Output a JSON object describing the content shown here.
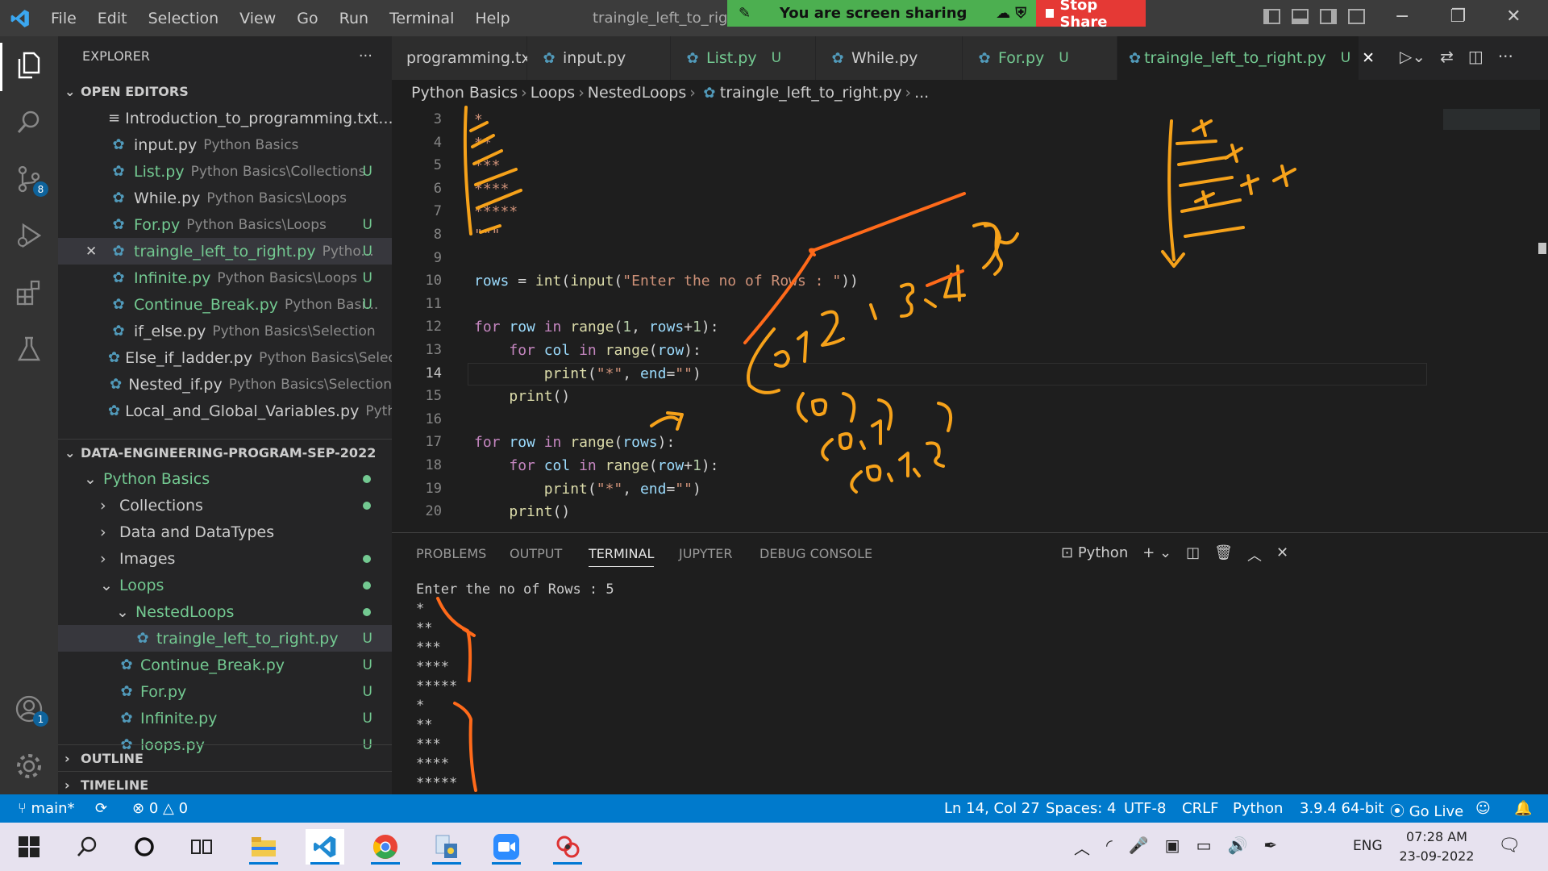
{
  "title_bar": {
    "menu": [
      "File",
      "Edit",
      "Selection",
      "View",
      "Go",
      "Run",
      "Terminal",
      "Help"
    ],
    "window_title": "traingle_left_to_right.",
    "share_message": "You are screen sharing",
    "stop_share": "Stop Share"
  },
  "activity_bar": {
    "source_control_badge": "8",
    "accounts_badge": "1"
  },
  "explorer": {
    "title": "EXPLORER",
    "more": "···",
    "open_editors_title": "OPEN EDITORS",
    "open_editors": [
      {
        "name": "Introduction_to_programming.txt...",
        "desc": "",
        "status": "",
        "icon": "text-file-icon"
      },
      {
        "name": "input.py",
        "desc": "Python Basics",
        "status": ""
      },
      {
        "name": "List.py",
        "desc": "Python Basics\\Collections",
        "status": "U"
      },
      {
        "name": "While.py",
        "desc": "Python Basics\\Loops",
        "status": ""
      },
      {
        "name": "For.py",
        "desc": "Python Basics\\Loops",
        "status": "U"
      },
      {
        "name": "traingle_left_to_right.py",
        "desc": "Pytho...",
        "status": "U"
      },
      {
        "name": "Infinite.py",
        "desc": "Python Basics\\Loops",
        "status": "U"
      },
      {
        "name": "Continue_Break.py",
        "desc": "Python Basi...",
        "status": "U"
      },
      {
        "name": "if_else.py",
        "desc": "Python Basics\\Selection",
        "status": ""
      },
      {
        "name": "Else_if_ladder.py",
        "desc": "Python Basics\\Selec...",
        "status": ""
      },
      {
        "name": "Nested_if.py",
        "desc": "Python Basics\\Selection",
        "status": ""
      },
      {
        "name": "Local_and_Global_Variables.py",
        "desc": "Pyth...",
        "status": ""
      }
    ],
    "workspace_title": "DATA-ENGINEERING-PROGRAM-SEP-2022",
    "tree": [
      {
        "name": "Python Basics",
        "type": "folder-open",
        "indent": 1,
        "dot": true
      },
      {
        "name": "Collections",
        "type": "folder",
        "indent": 2,
        "dot": true
      },
      {
        "name": "Data and DataTypes",
        "type": "folder",
        "indent": 2,
        "dot": false
      },
      {
        "name": "Images",
        "type": "folder",
        "indent": 2,
        "dot": true
      },
      {
        "name": "Loops",
        "type": "folder-open",
        "indent": 2,
        "dot": true
      },
      {
        "name": "NestedLoops",
        "type": "folder-open",
        "indent": 3,
        "dot": true
      },
      {
        "name": "traingle_left_to_right.py",
        "type": "file",
        "indent": 4,
        "status": "U"
      },
      {
        "name": "Continue_Break.py",
        "type": "file",
        "indent": 3,
        "status": "U"
      },
      {
        "name": "For.py",
        "type": "file",
        "indent": 3,
        "status": "U"
      },
      {
        "name": "Infinite.py",
        "type": "file",
        "indent": 3,
        "status": "U"
      },
      {
        "name": "loops.py",
        "type": "file",
        "indent": 3,
        "status": "U"
      }
    ],
    "outline": "OUTLINE",
    "timeline": "TIMELINE"
  },
  "tabs": [
    {
      "name": "programming.txt",
      "status": ""
    },
    {
      "name": "input.py",
      "status": ""
    },
    {
      "name": "List.py",
      "status": "U"
    },
    {
      "name": "While.py",
      "status": ""
    },
    {
      "name": "For.py",
      "status": "U"
    },
    {
      "name": "traingle_left_to_right.py",
      "status": "U"
    }
  ],
  "breadcrumb": [
    "Python Basics",
    "Loops",
    "NestedLoops",
    "traingle_left_to_right.py",
    "..."
  ],
  "editor": {
    "lines": [
      {
        "n": "3",
        "t": "*"
      },
      {
        "n": "4",
        "t": "**"
      },
      {
        "n": "5",
        "t": "***"
      },
      {
        "n": "6",
        "t": "****"
      },
      {
        "n": "7",
        "t": "*****"
      },
      {
        "n": "8",
        "t": "\"\"\""
      },
      {
        "n": "9",
        "t": ""
      },
      {
        "n": "10",
        "t": "rows = int(input(\"Enter the no of Rows : \"))"
      },
      {
        "n": "11",
        "t": ""
      },
      {
        "n": "12",
        "t": "for row in range(1, rows+1):"
      },
      {
        "n": "13",
        "t": "    for col in range(row):"
      },
      {
        "n": "14",
        "t": "        print(\"*\", end=\"\")"
      },
      {
        "n": "15",
        "t": "    print()"
      },
      {
        "n": "16",
        "t": ""
      },
      {
        "n": "17",
        "t": "for row in range(rows):"
      },
      {
        "n": "18",
        "t": "    for col in range(row+1):"
      },
      {
        "n": "19",
        "t": "        print(\"*\", end=\"\")"
      },
      {
        "n": "20",
        "t": "    print()"
      }
    ]
  },
  "panel": {
    "tabs": [
      "PROBLEMS",
      "OUTPUT",
      "TERMINAL",
      "JUPYTER",
      "DEBUG CONSOLE"
    ],
    "active_tab": "TERMINAL",
    "shell": "Python",
    "terminal": [
      "Enter the no of Rows : 5",
      "*",
      "**",
      "***",
      "****",
      "*****",
      "*",
      "**",
      "***",
      "****",
      "*****"
    ]
  },
  "status_bar": {
    "branch": "main*",
    "errors": "0",
    "warnings": "0",
    "position": "Ln 14, Col 27",
    "spaces": "Spaces: 4",
    "encoding": "UTF-8",
    "eol": "CRLF",
    "language": "Python",
    "interpreter": "3.9.4 64-bit",
    "live": "Go Live"
  },
  "taskbar": {
    "lang": "ENG",
    "time": "07:28 AM",
    "date": "23-09-2022"
  },
  "annotations": {
    "ink_color": "#f6a21a",
    "ink_color_2": "#ff6a1a",
    "lists": [
      "[0,1,2,3,4]",
      "[0]",
      "[0,1]",
      "[0,1,2]"
    ]
  },
  "colors": {
    "accent": "#007acc",
    "untracked": "#73c991",
    "share_green": "#4caf50",
    "stop_red": "#e53935"
  }
}
